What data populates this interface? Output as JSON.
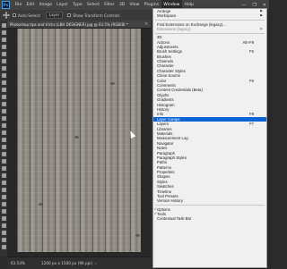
{
  "app_icon": "Ps",
  "menubar": {
    "items": [
      "File",
      "Edit",
      "Image",
      "Layer",
      "Type",
      "Select",
      "Filter",
      "3D",
      "View",
      "Plugins",
      "Window",
      "Help"
    ],
    "active": "Window",
    "window_controls": [
      "—",
      "❐",
      "✕"
    ]
  },
  "options_bar": {
    "auto_select_label": "Auto-Select:",
    "auto_select_value": "Layer",
    "show_transform_label": "Show Transform Controls"
  },
  "document": {
    "tab_title": "Photoshop tips and tricks (LBH DESIGNER).jpg @ 63.5% (RGB/8) *",
    "close_glyph": "✕"
  },
  "statusbar": {
    "zoom": "63.54%",
    "dims": "1200 px x 1500 px (96 ppi)",
    "arrow": "›"
  },
  "window_menu": {
    "groups": [
      [
        {
          "label": "Arrange",
          "submenu": true
        },
        {
          "label": "Workspace",
          "submenu": true
        }
      ],
      [
        {
          "label": "Find Extensions on Exchange (legacy)..."
        },
        {
          "label": "Extensions (legacy)",
          "submenu": true,
          "disabled": true
        }
      ],
      [
        {
          "label": "3D"
        },
        {
          "label": "Actions",
          "shortcut": "Alt+F9"
        },
        {
          "label": "Adjustments"
        },
        {
          "label": "Brush Settings",
          "shortcut": "F5"
        },
        {
          "label": "Brushes"
        },
        {
          "label": "Channels"
        },
        {
          "label": "Character"
        },
        {
          "label": "Character Styles"
        },
        {
          "label": "Clone Source"
        },
        {
          "label": "Color",
          "shortcut": "F6"
        },
        {
          "label": "Comments"
        },
        {
          "label": "Content Credentials (Beta)"
        },
        {
          "label": "Glyphs"
        },
        {
          "label": "Gradients"
        },
        {
          "label": "Histogram"
        },
        {
          "label": "History"
        },
        {
          "label": "Info",
          "shortcut": "F8"
        },
        {
          "label": "Layer Comps",
          "highlight": true
        },
        {
          "label": "Layers",
          "shortcut": "F7"
        },
        {
          "label": "Libraries"
        },
        {
          "label": "Materials"
        },
        {
          "label": "Measurement Log"
        },
        {
          "label": "Navigator"
        },
        {
          "label": "Notes"
        },
        {
          "label": "Paragraph"
        },
        {
          "label": "Paragraph Styles"
        },
        {
          "label": "Paths"
        },
        {
          "label": "Patterns"
        },
        {
          "label": "Properties"
        },
        {
          "label": "Shapes"
        },
        {
          "label": "Styles"
        },
        {
          "label": "Swatches"
        },
        {
          "label": "Timeline"
        },
        {
          "label": "Tool Presets"
        },
        {
          "label": "Version History"
        }
      ],
      [
        {
          "label": "Options",
          "checked": true
        },
        {
          "label": "Tools",
          "checked": true
        },
        {
          "label": "Contextual Task Bar"
        }
      ]
    ],
    "submenu_glyph": "▶",
    "check_glyph": "✓"
  },
  "colors": {
    "highlight": "#0a64d6",
    "menu_bg": "#f0f0f0",
    "app_bg": "#2b2b2b"
  },
  "icons": {
    "tool": "move-tool-icon",
    "app": "photoshop-logo-icon"
  }
}
